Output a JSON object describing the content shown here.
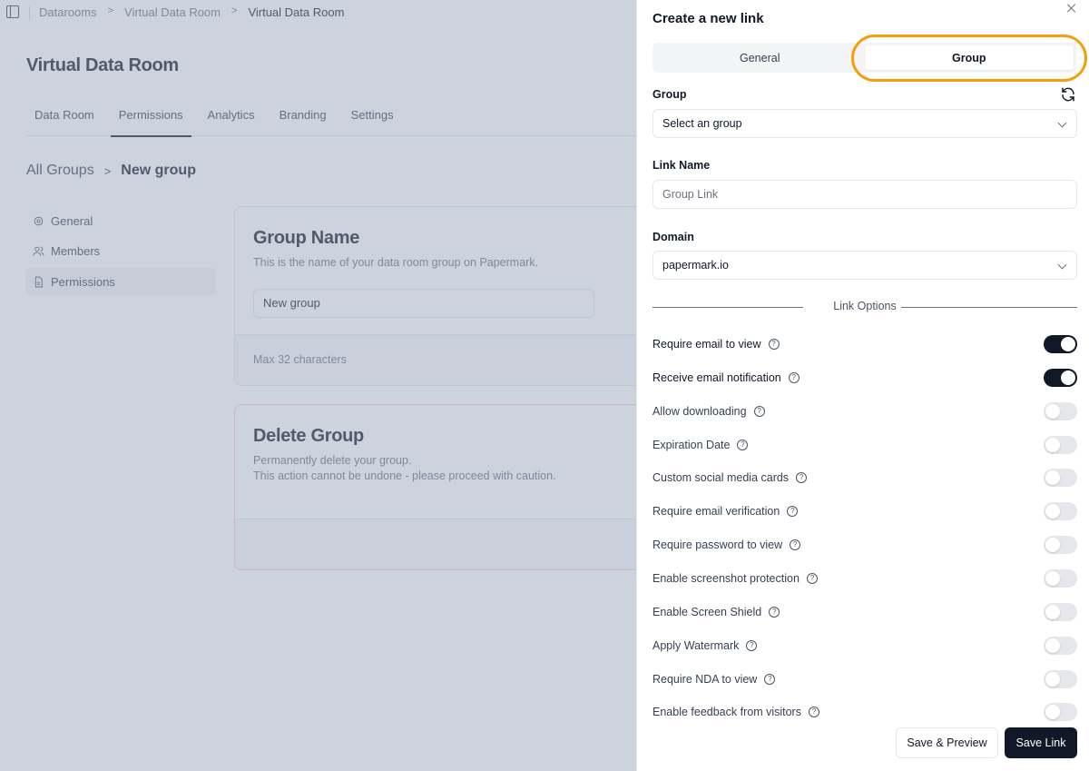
{
  "topbar": {
    "breadcrumb": [
      "Datarooms",
      "Virtual Data Room",
      "Virtual Data Room"
    ]
  },
  "page": {
    "title": "Virtual Data Room",
    "tabs": [
      {
        "label": "Data Room",
        "active": false
      },
      {
        "label": "Permissions",
        "active": true
      },
      {
        "label": "Analytics",
        "active": false
      },
      {
        "label": "Branding",
        "active": false
      },
      {
        "label": "Settings",
        "active": false
      }
    ],
    "sub_breadcrumb": {
      "parent": "All Groups",
      "current": "New group"
    },
    "side_nav": [
      {
        "label": "General",
        "icon": "settings-icon",
        "active": false
      },
      {
        "label": "Members",
        "icon": "users-icon",
        "active": false
      },
      {
        "label": "Permissions",
        "icon": "file-text-icon",
        "active": true
      }
    ],
    "group_name_card": {
      "title": "Group Name",
      "description": "This is the name of your data room group on Papermark.",
      "input_value": "New group",
      "footer": "Max 32 characters"
    },
    "delete_card": {
      "title": "Delete Group",
      "description_line1": "Permanently delete your group.",
      "description_line2": "This action cannot be undone - please proceed with caution."
    }
  },
  "sheet": {
    "title": "Create a new link",
    "tabs": [
      {
        "label": "General",
        "active": false
      },
      {
        "label": "Group",
        "active": true
      }
    ],
    "highlight_color": "#f59e0b",
    "group_field": {
      "label": "Group",
      "placeholder": "Select an group"
    },
    "link_name_field": {
      "label": "Link Name",
      "placeholder": "Group Link"
    },
    "domain_field": {
      "label": "Domain",
      "value": "papermark.io"
    },
    "divider_label": "Link Options",
    "options": [
      {
        "label": "Require email to view",
        "enabled": true
      },
      {
        "label": "Receive email notification",
        "enabled": true
      },
      {
        "label": "Allow downloading",
        "enabled": false
      },
      {
        "label": "Expiration Date",
        "enabled": false
      },
      {
        "label": "Custom social media cards",
        "enabled": false
      },
      {
        "label": "Require email verification",
        "enabled": false
      },
      {
        "label": "Require password to view",
        "enabled": false
      },
      {
        "label": "Enable screenshot protection",
        "enabled": false
      },
      {
        "label": "Enable Screen Shield",
        "enabled": false
      },
      {
        "label": "Apply Watermark",
        "enabled": false
      },
      {
        "label": "Require NDA to view",
        "enabled": false
      },
      {
        "label": "Enable feedback from visitors",
        "enabled": false
      }
    ],
    "buttons": {
      "save_preview": "Save & Preview",
      "save_link": "Save Link"
    }
  }
}
